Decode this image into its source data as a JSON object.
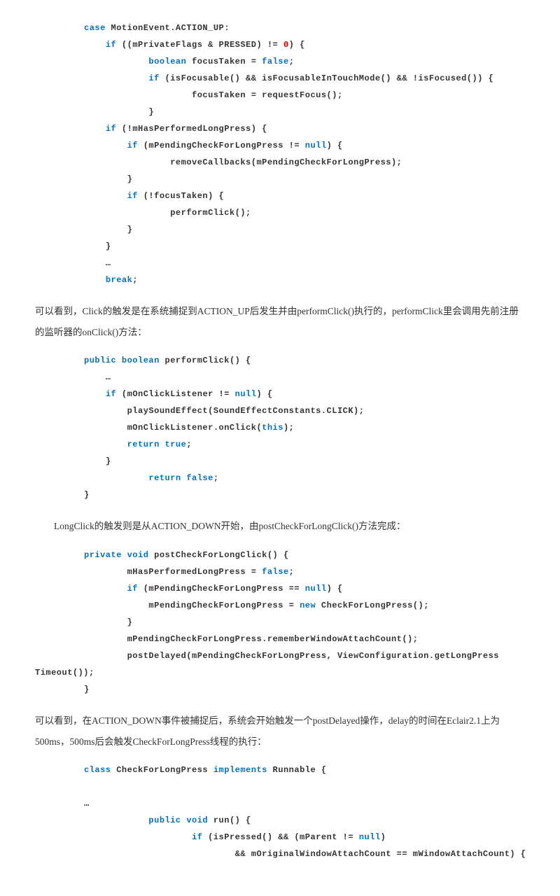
{
  "code_block_1": [
    {
      "indent": 0,
      "segs": [
        {
          "t": "case ",
          "c": "kw"
        },
        {
          "t": "MotionEvent.ACTION_UP:"
        }
      ]
    },
    {
      "indent": 1,
      "segs": [
        {
          "t": "if",
          "c": "kw"
        },
        {
          "t": " ((mPrivateFlags & PRESSED) != "
        },
        {
          "t": "0",
          "c": "num"
        },
        {
          "t": ") {"
        }
      ]
    },
    {
      "indent": 3,
      "segs": [
        {
          "t": "boolean",
          "c": "kw"
        },
        {
          "t": " focusTaken = "
        },
        {
          "t": "false",
          "c": "kw"
        },
        {
          "t": ";"
        }
      ]
    },
    {
      "indent": 3,
      "segs": [
        {
          "t": "if",
          "c": "kw"
        },
        {
          "t": " (isFocusable() && isFocusableInTouchMode() && !isFocused()) {"
        }
      ]
    },
    {
      "indent": 5,
      "segs": [
        {
          "t": "focusTaken = requestFocus();"
        }
      ]
    },
    {
      "indent": 3,
      "segs": [
        {
          "t": "}"
        }
      ]
    },
    {
      "indent": 1,
      "segs": [
        {
          "t": "if",
          "c": "kw"
        },
        {
          "t": " (!mHasPerformedLongPress) {"
        }
      ]
    },
    {
      "indent": 2,
      "segs": [
        {
          "t": "if",
          "c": "kw"
        },
        {
          "t": " (mPendingCheckForLongPress != "
        },
        {
          "t": "null",
          "c": "kw"
        },
        {
          "t": ") {"
        }
      ]
    },
    {
      "indent": 4,
      "segs": [
        {
          "t": "removeCallbacks(mPendingCheckForLongPress);"
        }
      ]
    },
    {
      "indent": 2,
      "segs": [
        {
          "t": "}"
        }
      ]
    },
    {
      "indent": 2,
      "segs": [
        {
          "t": "if",
          "c": "kw"
        },
        {
          "t": " (!focusTaken) {"
        }
      ]
    },
    {
      "indent": 4,
      "segs": [
        {
          "t": "performClick();"
        }
      ]
    },
    {
      "indent": 2,
      "segs": [
        {
          "t": "}"
        }
      ]
    },
    {
      "indent": 1,
      "segs": [
        {
          "t": "}"
        }
      ]
    },
    {
      "indent": 1,
      "segs": [
        {
          "t": "…"
        }
      ]
    },
    {
      "indent": 1,
      "segs": [
        {
          "t": "break",
          "c": "kw"
        },
        {
          "t": ";"
        }
      ]
    }
  ],
  "paragraph_1": "可以看到，Click的触发是在系统捕捉到ACTION_UP后发生并由performClick()执行的，performClick里会调用先前注册的监听器的onClick()方法：",
  "code_block_2": [
    {
      "indent": 0,
      "segs": [
        {
          "t": "public boolean",
          "c": "kw"
        },
        {
          "t": " performClick() {"
        }
      ]
    },
    {
      "indent": 1,
      "segs": [
        {
          "t": "…"
        }
      ]
    },
    {
      "indent": 1,
      "segs": [
        {
          "t": "if",
          "c": "kw"
        },
        {
          "t": " (mOnClickListener != "
        },
        {
          "t": "null",
          "c": "kw"
        },
        {
          "t": ") {"
        }
      ]
    },
    {
      "indent": 2,
      "segs": [
        {
          "t": "playSoundEffect(SoundEffectConstants.CLICK);"
        }
      ]
    },
    {
      "indent": 2,
      "segs": [
        {
          "t": "mOnClickListener.onClick("
        },
        {
          "t": "this",
          "c": "kw"
        },
        {
          "t": ");"
        }
      ]
    },
    {
      "indent": 2,
      "segs": [
        {
          "t": "return true",
          "c": "kw"
        },
        {
          "t": ";"
        }
      ]
    },
    {
      "indent": 1,
      "segs": [
        {
          "t": "}"
        }
      ]
    },
    {
      "indent": 3,
      "segs": [
        {
          "t": "return false",
          "c": "kw"
        },
        {
          "t": ";"
        }
      ]
    },
    {
      "indent": 0,
      "segs": [
        {
          "t": "}"
        }
      ]
    }
  ],
  "paragraph_2": "LongClick的触发则是从ACTION_DOWN开始，由postCheckForLongClick()方法完成：",
  "code_block_3": [
    {
      "indent": 0,
      "segs": [
        {
          "t": "private void",
          "c": "kw"
        },
        {
          "t": " postCheckForLongClick() {"
        }
      ]
    },
    {
      "indent": 2,
      "segs": [
        {
          "t": "mHasPerformedLongPress = "
        },
        {
          "t": "false",
          "c": "kw"
        },
        {
          "t": ";"
        }
      ]
    },
    {
      "indent": 2,
      "segs": [
        {
          "t": "if",
          "c": "kw"
        },
        {
          "t": " (mPendingCheckForLongPress == "
        },
        {
          "t": "null",
          "c": "kw"
        },
        {
          "t": ") {"
        }
      ]
    },
    {
      "indent": 3,
      "segs": [
        {
          "t": "mPendingCheckForLongPress = "
        },
        {
          "t": "new",
          "c": "kw"
        },
        {
          "t": " CheckForLongPress();"
        }
      ]
    },
    {
      "indent": 2,
      "segs": [
        {
          "t": "}"
        }
      ]
    },
    {
      "indent": 2,
      "segs": [
        {
          "t": "mPendingCheckForLongPress.rememberWindowAttachCount();"
        }
      ]
    },
    {
      "indent": 2,
      "segs": [
        {
          "t": "postDelayed(mPendingCheckForLongPress, ViewConfiguration.getLongPress"
        }
      ]
    },
    {
      "indent": -1,
      "segs": [
        {
          "t": "Timeout());"
        }
      ]
    },
    {
      "indent": 0,
      "segs": [
        {
          "t": "}"
        }
      ]
    }
  ],
  "paragraph_3": "可以看到，在ACTION_DOWN事件被捕捉后，系统会开始触发一个postDelayed操作，delay的时间在Eclair2.1上为500ms，500ms后会触发CheckForLongPress线程的执行：",
  "code_block_4": [
    {
      "indent": 0,
      "segs": [
        {
          "t": "class",
          "c": "kw"
        },
        {
          "t": " CheckForLongPress "
        },
        {
          "t": "implements",
          "c": "kw"
        },
        {
          "t": " Runnable {"
        }
      ]
    },
    {
      "indent": 0,
      "segs": [
        {
          "t": " "
        }
      ]
    },
    {
      "indent": 0,
      "segs": [
        {
          "t": "…"
        }
      ]
    },
    {
      "indent": 3,
      "segs": [
        {
          "t": "public void",
          "c": "kw"
        },
        {
          "t": " run() {"
        }
      ]
    },
    {
      "indent": 5,
      "segs": [
        {
          "t": "if",
          "c": "kw"
        },
        {
          "t": " (isPressed() && (mParent != "
        },
        {
          "t": "null",
          "c": "kw"
        },
        {
          "t": ")"
        }
      ]
    },
    {
      "indent": 7,
      "segs": [
        {
          "t": "&& mOriginalWindowAttachCount == mWindowAttachCount) {"
        }
      ]
    }
  ]
}
